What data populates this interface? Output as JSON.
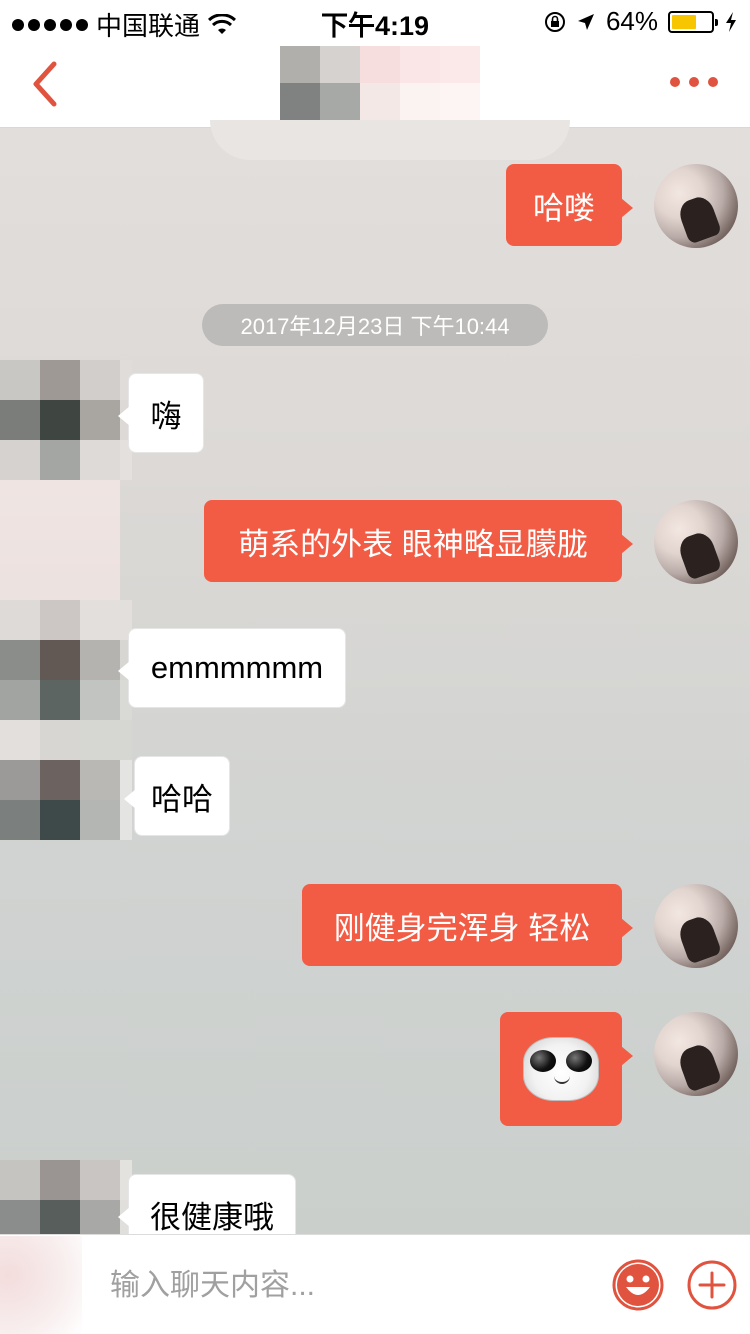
{
  "status_bar": {
    "carrier": "中国联通",
    "time": "下午4:19",
    "battery_percent": "64%",
    "battery_level": 0.64,
    "icons": [
      "signal-dots-icon",
      "wifi-icon",
      "rotation-lock-icon",
      "location-arrow-icon",
      "battery-icon",
      "charging-bolt-icon"
    ]
  },
  "nav": {
    "back_icon": "chevron-left-icon",
    "more_icon": "more-dots-icon",
    "accent_color": "#e0533f"
  },
  "messages": [
    {
      "side": "out",
      "text": "哈喽"
    },
    {
      "type": "timestamp",
      "text": "2017年12月23日 下午10:44"
    },
    {
      "side": "in",
      "text": "嗨"
    },
    {
      "side": "out",
      "text": "萌系的外表 眼神略显朦胧"
    },
    {
      "side": "in",
      "text": "emmmmmm"
    },
    {
      "side": "in",
      "text": "哈哈"
    },
    {
      "side": "out",
      "text": "刚健身完浑身 轻松"
    },
    {
      "side": "out",
      "type": "sticker",
      "sticker": "panda-face-emoji"
    },
    {
      "side": "in",
      "text": "很健康哦"
    }
  ],
  "input": {
    "placeholder": "输入聊天内容..."
  },
  "colors": {
    "outgoing_bubble": "#f25c45",
    "incoming_bubble": "#ffffff"
  }
}
